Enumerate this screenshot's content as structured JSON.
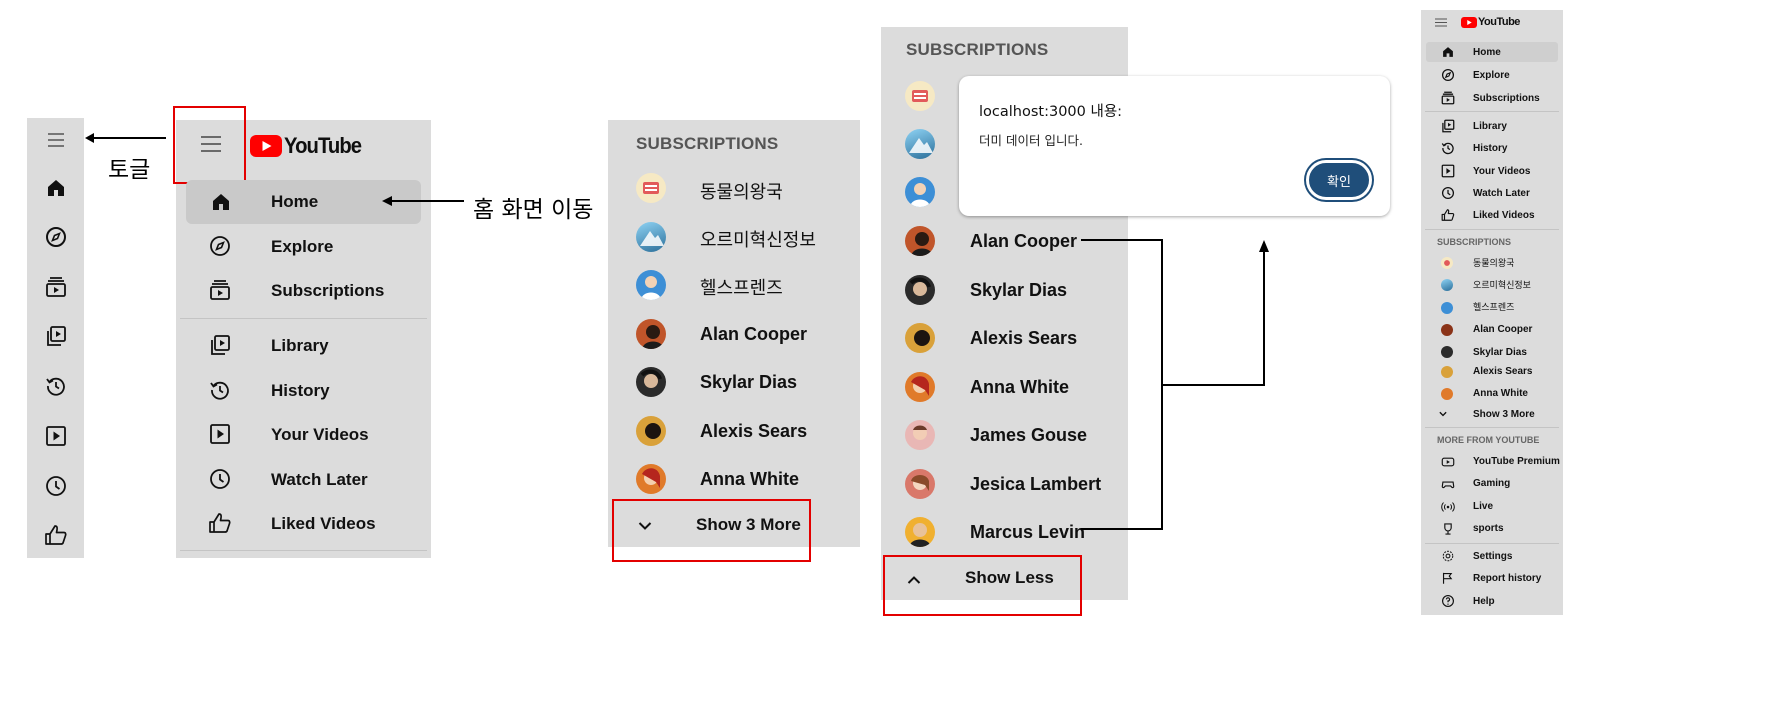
{
  "annotations": {
    "toggle": "토글",
    "home_nav": "홈 화면 이동"
  },
  "logo": {
    "text": "YouTube"
  },
  "nav": {
    "home": "Home",
    "explore": "Explore",
    "subscriptions": "Subscriptions",
    "library": "Library",
    "history": "History",
    "your_videos": "Your Videos",
    "watch_later": "Watch Later",
    "liked_videos": "Liked Videos"
  },
  "subscriptions": {
    "header": "SUBSCRIPTIONS",
    "channels": [
      "동물의왕국",
      "오르미혁신정보",
      "헬스프렌즈",
      "Alan Cooper",
      "Skylar Dias",
      "Alexis Sears",
      "Anna White",
      "James Gouse",
      "Jesica Lambert",
      "Marcus Levin"
    ],
    "show_more": "Show 3 More",
    "show_less": "Show Less"
  },
  "dialog": {
    "title": "localhost:3000 내용:",
    "message": "더미 데이터 입니다.",
    "ok": "확인"
  },
  "more_from_youtube": {
    "header": "MORE FROM YOUTUBE",
    "items": [
      "YouTube Premium",
      "Gaming",
      "Live",
      "sports"
    ]
  },
  "footer": {
    "settings": "Settings",
    "report_history": "Report history",
    "help": "Help"
  },
  "colors": {
    "sidebar_bg": "#dcdcdc",
    "active_bg": "#cfcfcf",
    "brand_red": "#ff0000",
    "highlight_red": "#e30000",
    "dialog_button": "#1f4e7a"
  }
}
